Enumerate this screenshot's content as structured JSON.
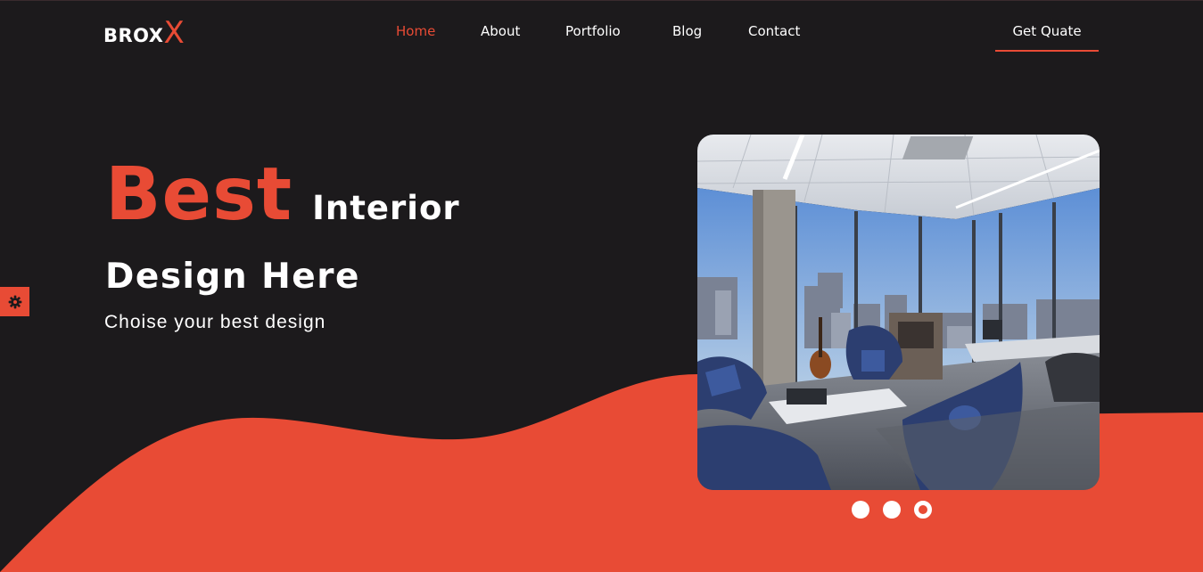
{
  "brand": {
    "name": "BROX",
    "mark": "X",
    "accent_color": "#e84b35",
    "background_color": "#1c1a1c"
  },
  "nav": {
    "items": [
      {
        "label": "Home",
        "active": true
      },
      {
        "label": "About",
        "active": false
      },
      {
        "label": "Portfolio",
        "active": false
      },
      {
        "label": "Blog",
        "active": false
      },
      {
        "label": "Contact",
        "active": false
      }
    ],
    "cta_label": "Get Quate"
  },
  "hero": {
    "highlight": "Best",
    "title_rest": "Interior",
    "line2": "Design Here",
    "subtitle": "Choise your best design"
  },
  "settings": {
    "icon": "gear-icon"
  },
  "slider": {
    "dot_count": 3,
    "active_index": 2
  }
}
